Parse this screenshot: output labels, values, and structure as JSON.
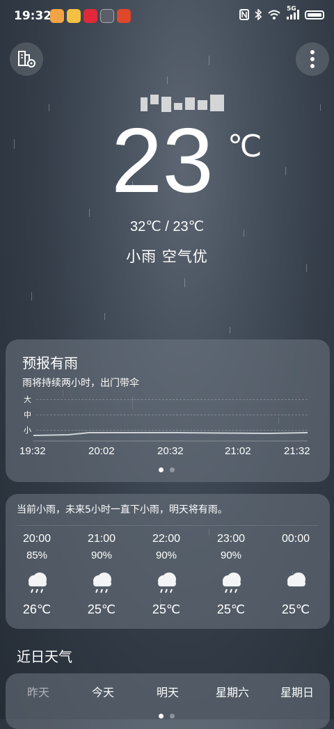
{
  "status_bar": {
    "time": "19:32",
    "network": "5G",
    "apps": [
      {
        "icon": "weather-app-icon",
        "color": "#f0a040"
      },
      {
        "icon": "weibo-app-icon",
        "color": "#e8a020"
      },
      {
        "icon": "xiaohongshu-app-icon",
        "color": "#e02a3a"
      },
      {
        "icon": "hand-app-icon",
        "color": "#666a70"
      },
      {
        "icon": "game-app-icon",
        "color": "#e0482a"
      }
    ],
    "system_icons": [
      "nfc-icon",
      "bluetooth-icon",
      "wifi-icon",
      "signal-icon",
      "battery-icon"
    ]
  },
  "current": {
    "temperature": "23",
    "unit": "℃",
    "range": "32℃ / 23℃",
    "condition": "小雨 空气优"
  },
  "rain_forecast": {
    "title": "预报有雨",
    "subtitle": "雨将持续两小时，出门带伞",
    "levels": [
      "大",
      "中",
      "小"
    ],
    "times": [
      "19:32",
      "20:02",
      "20:32",
      "21:02",
      "21:32"
    ],
    "page_count": 2,
    "active_page": 0
  },
  "hourly": {
    "summary": "当前小雨，未来5小时一直下小雨，明天将有雨。",
    "items": [
      {
        "time": "20:00",
        "precip": "85%",
        "icon": "rain-cloud-icon",
        "temp": "26℃"
      },
      {
        "time": "21:00",
        "precip": "90%",
        "icon": "rain-cloud-icon",
        "temp": "25℃"
      },
      {
        "time": "22:00",
        "precip": "90%",
        "icon": "rain-cloud-icon",
        "temp": "25℃"
      },
      {
        "time": "23:00",
        "precip": "90%",
        "icon": "rain-cloud-icon",
        "temp": "25℃"
      },
      {
        "time": "00:00",
        "precip": "",
        "icon": "cloud-icon",
        "temp": "25℃"
      }
    ]
  },
  "recent": {
    "title": "近日天气",
    "days": [
      "昨天",
      "今天",
      "明天",
      "星期六",
      "星期日"
    ]
  }
}
